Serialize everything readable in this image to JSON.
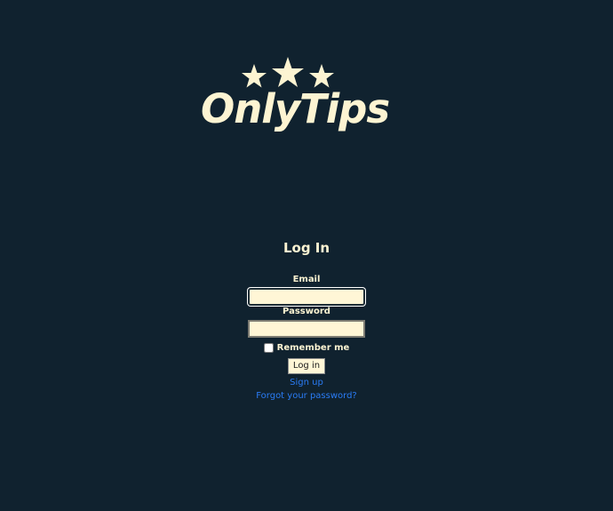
{
  "logo": {
    "text": "OnlyTips",
    "stars_icon": "three-stars-icon",
    "color": "#fdf4d2"
  },
  "form": {
    "title": "Log In",
    "email_label": "Email",
    "email_value": "",
    "password_label": "Password",
    "password_value": "",
    "remember_label": "Remember me",
    "remember_checked": false,
    "login_button": "Log in",
    "signup_link": "Sign up",
    "forgot_link": "Forgot your password?"
  },
  "colors": {
    "background": "#10222f",
    "text": "#fdf4d2",
    "input_bg": "#fff6d6",
    "link": "#2a7cf6"
  }
}
